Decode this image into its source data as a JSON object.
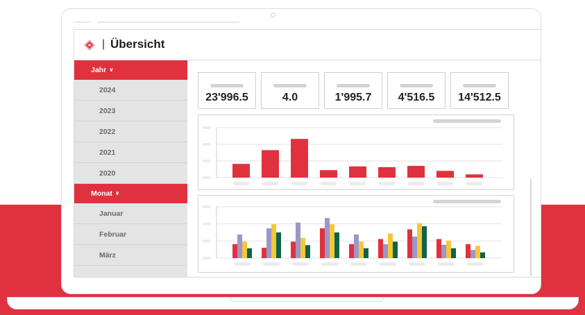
{
  "app": {
    "title": "Übersicht",
    "logo_separator": "|",
    "brand_color": "#e0313f"
  },
  "sidebar": {
    "year_section": {
      "label": "Jahr",
      "expanded": true,
      "items": [
        "2024",
        "2023",
        "2022",
        "2021",
        "2020"
      ]
    },
    "month_section": {
      "label": "Monat",
      "expanded": true,
      "items": [
        "Januar",
        "Februar",
        "März"
      ]
    }
  },
  "kpis": [
    {
      "value": "23'996.5"
    },
    {
      "value": "4.0"
    },
    {
      "value": "1'995.7"
    },
    {
      "value": "4'516.5"
    },
    {
      "value": "14'512.5"
    }
  ],
  "chart_data": [
    {
      "type": "bar",
      "series": [
        {
          "color": "#e0313f",
          "values": [
            5.5,
            11.0,
            15.5,
            3.0,
            4.5,
            4.2,
            4.7,
            2.7,
            1.3
          ]
        }
      ],
      "ylim": [
        0,
        20
      ],
      "grid": true
    },
    {
      "type": "bar",
      "series": [
        {
          "color": "#e0313f",
          "values": [
            6.8,
            5.0,
            8.0,
            14.5,
            6.8,
            9.3,
            14.0,
            9.3,
            6.8
          ]
        },
        {
          "color": "#9a97c9",
          "values": [
            11.5,
            14.5,
            17.3,
            19.5,
            11.5,
            6.8,
            10.5,
            6.5,
            4.0
          ]
        },
        {
          "color": "#f5c739",
          "values": [
            8.0,
            16.5,
            9.8,
            16.5,
            8.0,
            12.0,
            17.0,
            8.5,
            6.0
          ]
        },
        {
          "color": "#0d6446",
          "values": [
            4.8,
            12.5,
            6.3,
            12.5,
            4.8,
            8.0,
            15.5,
            4.8,
            2.8
          ]
        }
      ],
      "ylim": [
        0,
        25
      ],
      "grid": true
    }
  ]
}
